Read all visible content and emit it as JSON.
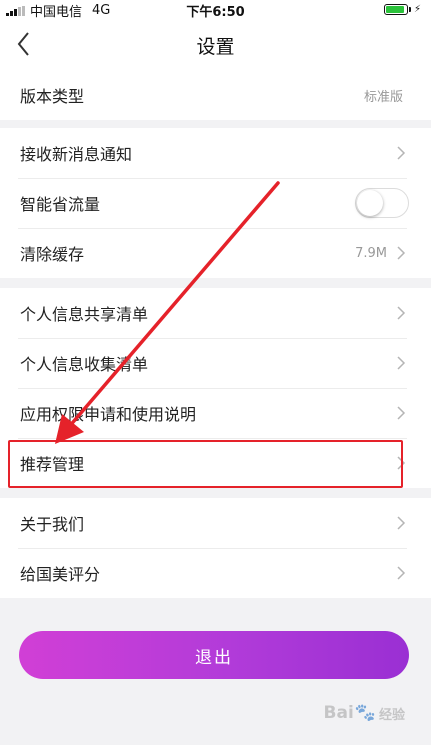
{
  "status_bar": {
    "carrier": "中国电信",
    "network": "4G",
    "time": "下午6:50"
  },
  "nav": {
    "title": "设置"
  },
  "groups": [
    {
      "rows": [
        {
          "label": "版本类型",
          "value": "标准版"
        }
      ]
    },
    {
      "rows": [
        {
          "label": "接收新消息通知"
        },
        {
          "label": "智能省流量",
          "toggle_on": false
        },
        {
          "label": "清除缓存",
          "value": "7.9M"
        }
      ]
    },
    {
      "rows": [
        {
          "label": "个人信息共享清单"
        },
        {
          "label": "个人信息收集清单"
        },
        {
          "label": "应用权限申请和使用说明"
        },
        {
          "label": "推荐管理"
        }
      ]
    },
    {
      "rows": [
        {
          "label": "关于我们"
        },
        {
          "label": "给国美评分"
        }
      ]
    }
  ],
  "logout": {
    "label": "退出"
  },
  "annotation": {
    "color": "#e5222a"
  },
  "watermark": {
    "text": "Bai",
    "suffix": "经验"
  },
  "colors": {
    "accent_start": "#d13fd6",
    "accent_end": "#9a2fd3"
  }
}
